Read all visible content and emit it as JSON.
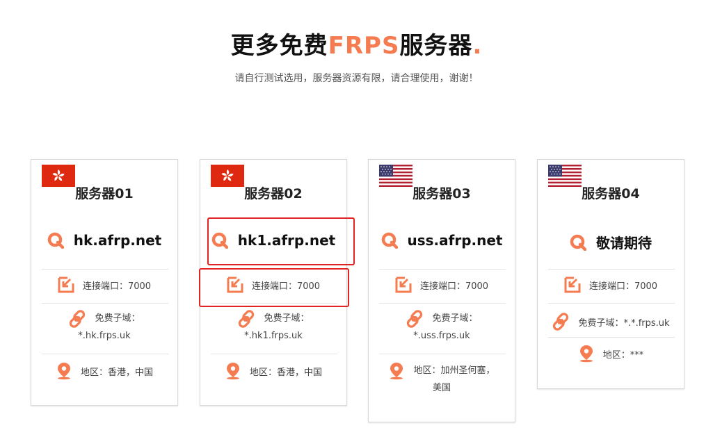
{
  "header": {
    "title_part1": "更多免费",
    "title_highlight": "FRPS",
    "title_part2": "服务器",
    "title_dot": ".",
    "subtitle": "请自行测试选用，服务器资源有限，请合理使用，谢谢！"
  },
  "colors": {
    "accent": "#f57c51",
    "annotation": "#e02424"
  },
  "cards": [
    {
      "flag": "hong-kong-flag",
      "name": "服务器01",
      "host": "hk.afrp.net",
      "port": "连接端口：7000",
      "subdomain_label": "免费子域：",
      "subdomain_value": "*.hk.frps.uk",
      "region": "地区：香港，中国"
    },
    {
      "flag": "hong-kong-flag",
      "name": "服务器02",
      "host": "hk1.afrp.net",
      "port": "连接端口：7000",
      "subdomain_label": "免费子域：",
      "subdomain_value": "*.hk1.frps.uk",
      "region": "地区：香港，中国"
    },
    {
      "flag": "usa-flag",
      "name": "服务器03",
      "host": "uss.afrp.net",
      "port": "连接端口：7000",
      "subdomain_label": "免费子域：",
      "subdomain_value": "*.uss.frps.uk",
      "region_line1": "地区：加州圣何塞，",
      "region_line2": "美国"
    },
    {
      "flag": "usa-flag",
      "name": "服务器04",
      "host": "敬请期待",
      "port": "连接端口：7000",
      "subdomain": "免费子域：*.*.frps.uk",
      "region": "地区：***"
    }
  ]
}
